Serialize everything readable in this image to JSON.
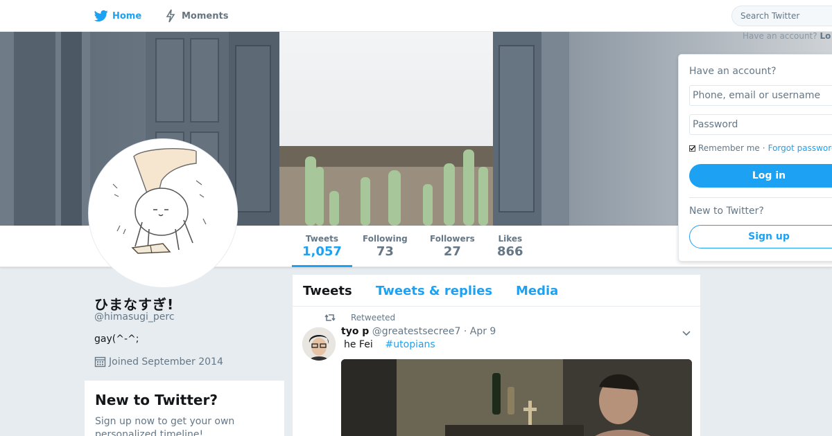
{
  "nav": {
    "home_label": "Home",
    "moments_label": "Moments",
    "search_placeholder": "Search Twitter",
    "have_account_prefix": "Have an account?",
    "have_account_login": "Lo"
  },
  "stats": [
    {
      "label": "Tweets",
      "value": "1,057"
    },
    {
      "label": "Following",
      "value": "73"
    },
    {
      "label": "Followers",
      "value": "27"
    },
    {
      "label": "Likes",
      "value": "866"
    }
  ],
  "profile": {
    "name": "ひまなすぎ!",
    "handle": "@himasugi_perc",
    "bio": "gay(^-^;",
    "joined": "Joined September 2014"
  },
  "signup_card": {
    "title": "New to Twitter?",
    "text": "Sign up now to get your own personalized timeline!"
  },
  "timeline": {
    "tabs": [
      "Tweets",
      "Tweets & replies",
      "Media"
    ],
    "tweet": {
      "retweeted_label": "Retweeted",
      "author_name": "tyo p",
      "author_handle": "@greatestsecree7",
      "date": "· Apr 9",
      "text": "he Fei",
      "hashtag": "#utopians"
    }
  },
  "login": {
    "heading": "Have an account?",
    "username_placeholder": "Phone, email or username",
    "password_placeholder": "Password",
    "remember_label": "Remember me",
    "separator": "·",
    "forgot_label": "Forgot password?",
    "login_button": "Log in",
    "new_prompt": "New to Twitter?",
    "signup_button": "Sign up"
  },
  "colors": {
    "accent": "#1da1f2",
    "page_bg": "#e6ecf0",
    "muted_text": "#657786"
  },
  "icons": [
    "twitter-bird-icon",
    "lightning-icon",
    "calendar-icon",
    "retweet-icon",
    "chevron-down-icon"
  ]
}
